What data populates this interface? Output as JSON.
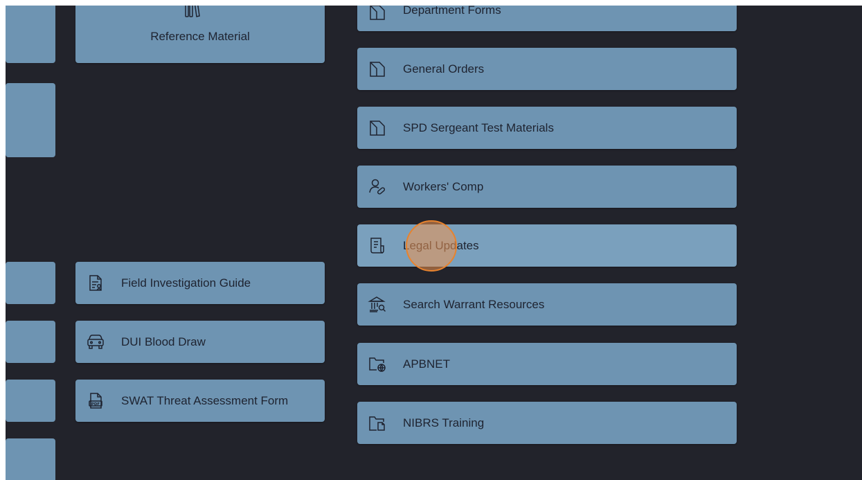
{
  "colors": {
    "background": "#22232b",
    "tile": "#6e94b2",
    "tile_hover": "#7aa0bd",
    "text": "#1e2330",
    "cursor_ring": "#e8832e"
  },
  "center_column": {
    "reference": {
      "label": "Reference Material",
      "icon": "books-icon"
    },
    "items": [
      {
        "label": "Field Investigation Guide",
        "icon": "document-person-icon"
      },
      {
        "label": "DUI Blood Draw",
        "icon": "car-icon"
      },
      {
        "label": "SWAT Threat Assessment Form",
        "icon": "pdf-file-icon"
      }
    ]
  },
  "right_column": {
    "items": [
      {
        "label": "Department Forms",
        "icon": "folded-doc-icon"
      },
      {
        "label": "General Orders",
        "icon": "folded-doc-icon"
      },
      {
        "label": "SPD Sergeant Test Materials",
        "icon": "folded-doc-icon"
      },
      {
        "label": "Workers' Comp",
        "icon": "person-bandage-icon"
      },
      {
        "label": "Legal Updates",
        "icon": "document-list-icon"
      },
      {
        "label": "Search Warrant Resources",
        "icon": "courthouse-search-icon"
      },
      {
        "label": "APBNET",
        "icon": "folder-globe-icon"
      },
      {
        "label": "NIBRS Training",
        "icon": "folder-doc-icon"
      }
    ]
  }
}
